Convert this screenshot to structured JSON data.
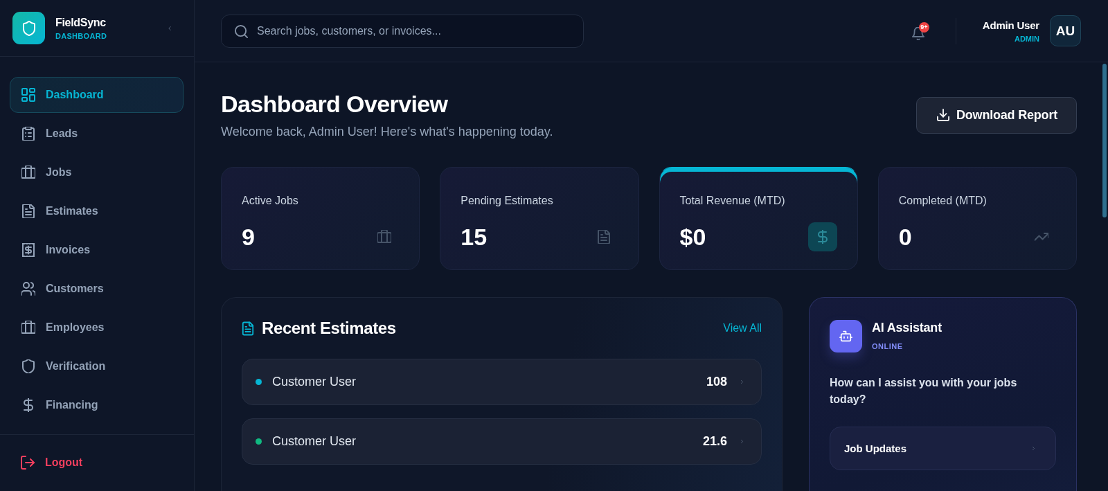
{
  "sidebar": {
    "brand": {
      "name": "FieldSync",
      "subtitle": "DASHBOARD"
    },
    "items": [
      {
        "label": "Dashboard",
        "selected": true
      },
      {
        "label": "Leads",
        "selected": false
      },
      {
        "label": "Jobs",
        "selected": false
      },
      {
        "label": "Estimates",
        "selected": false
      },
      {
        "label": "Invoices",
        "selected": false
      },
      {
        "label": "Customers",
        "selected": false
      },
      {
        "label": "Employees",
        "selected": false
      },
      {
        "label": "Verification",
        "selected": false
      },
      {
        "label": "Financing",
        "selected": false
      }
    ],
    "logout": {
      "label": "Logout"
    }
  },
  "topbar": {
    "search": {
      "placeholder": "Search jobs, customers, or invoices..."
    },
    "notifications": {
      "badge": "9+"
    },
    "user": {
      "name": "Admin User",
      "role": "ADMIN",
      "initials": "AU"
    }
  },
  "header": {
    "title": "Dashboard Overview",
    "subtitle": "Welcome back, Admin User! Here's what's happening today.",
    "button": "Download Report"
  },
  "stats": [
    {
      "label": "Active Jobs",
      "value": "9",
      "highlighted": false
    },
    {
      "label": "Pending Estimates",
      "value": "15",
      "highlighted": false
    },
    {
      "label": "Total Revenue (MTD)",
      "value": "$0",
      "highlighted": true
    },
    {
      "label": "Completed (MTD)",
      "value": "0",
      "highlighted": false
    }
  ],
  "recent_estimates": {
    "title": "Recent Estimates",
    "link": "View All",
    "rows": [
      {
        "customer": "Customer User",
        "amount": "108",
        "color": "#06b6d4"
      },
      {
        "customer": "Customer User",
        "amount": "21.6",
        "color": "#10b981"
      }
    ]
  },
  "ai_assistant": {
    "title": "AI Assistant",
    "status": "ONLINE",
    "prompt": "How can I assist you with your jobs today?",
    "actions": [
      "Job Updates"
    ]
  }
}
